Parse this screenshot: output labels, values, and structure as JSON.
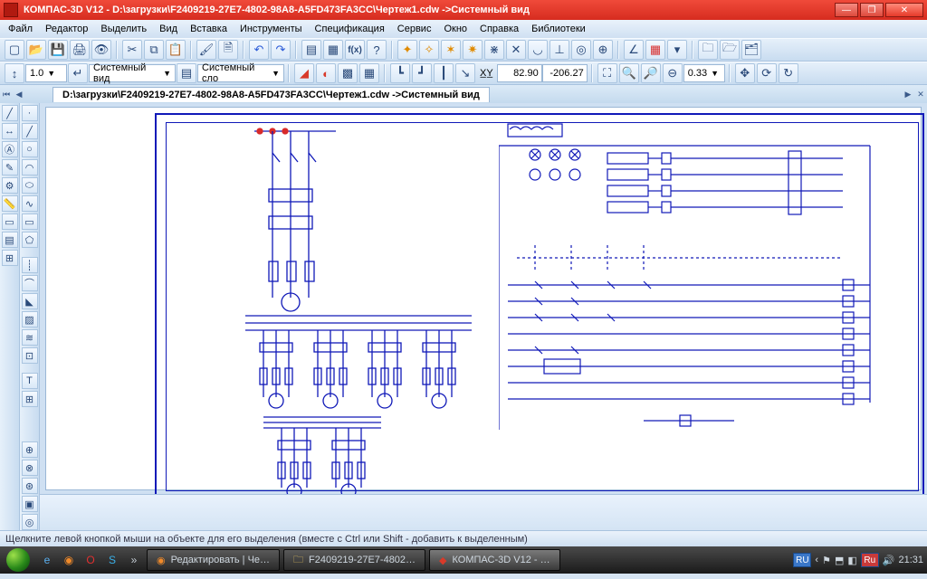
{
  "titlebar": {
    "text": "КОМПАС-3D V12 - D:\\загрузки\\F2409219-27E7-4802-98A8-A5FD473FA3CC\\Чертеж1.cdw ->Системный вид"
  },
  "menu": {
    "items": [
      "Файл",
      "Редактор",
      "Выделить",
      "Вид",
      "Вставка",
      "Инструменты",
      "Спецификация",
      "Сервис",
      "Окно",
      "Справка",
      "Библиотеки"
    ]
  },
  "toolbar2": {
    "scale_combo": "1.0",
    "view_combo": "Системный вид",
    "layer_combo": "Системный сло",
    "coord_x": "82.90",
    "coord_y": "-206.27",
    "zoom": "0.33"
  },
  "doctab": {
    "label": "D:\\загрузки\\F2409219-27E7-4802-98A8-A5FD473FA3CC\\Чертеж1.cdw ->Системный вид"
  },
  "status": {
    "text": "Щелкните левой кнопкой мыши на объекте для его выделения (вместе с Ctrl или Shift - добавить к выделенным)"
  },
  "taskbar": {
    "btn1": "Редактировать | Че…",
    "btn2": "F2409219-27E7-4802…",
    "btn3": "КОМПАС-3D V12 - …",
    "lang1": "RU",
    "lang2": "Ru",
    "clock": "21:31"
  }
}
